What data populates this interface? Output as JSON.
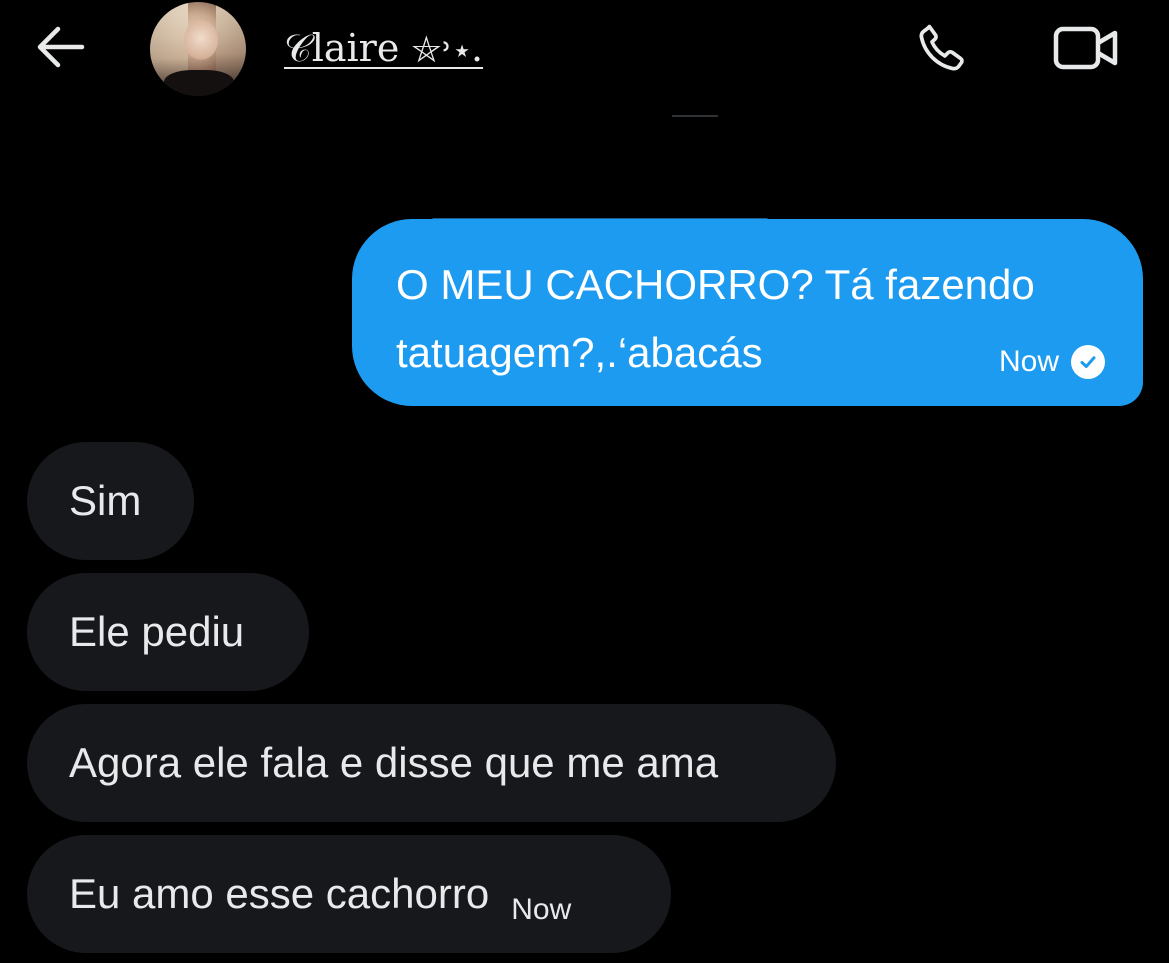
{
  "header": {
    "back_icon": "arrow-left-icon",
    "contact_name": "𝒞laire ⛤˒⋆.",
    "call_icon": "phone-icon",
    "video_icon": "video-camera-icon"
  },
  "messages": [
    {
      "direction": "outgoing",
      "text": "O MEU CACHORRO? Tá fazendo tatuagem?,.‘abacás",
      "time": "Now",
      "status_icon": "check-circle-icon"
    },
    {
      "direction": "incoming",
      "text": "Sim"
    },
    {
      "direction": "incoming",
      "text": "Ele pediu"
    },
    {
      "direction": "incoming",
      "text": "Agora ele fala e disse que me ama"
    },
    {
      "direction": "incoming",
      "text": "Eu amo esse cachorro",
      "time": "Now"
    }
  ],
  "colors": {
    "background": "#000000",
    "outgoing_bubble": "#1d9bf0",
    "incoming_bubble": "#16181c",
    "text": "#e7e9ea"
  }
}
